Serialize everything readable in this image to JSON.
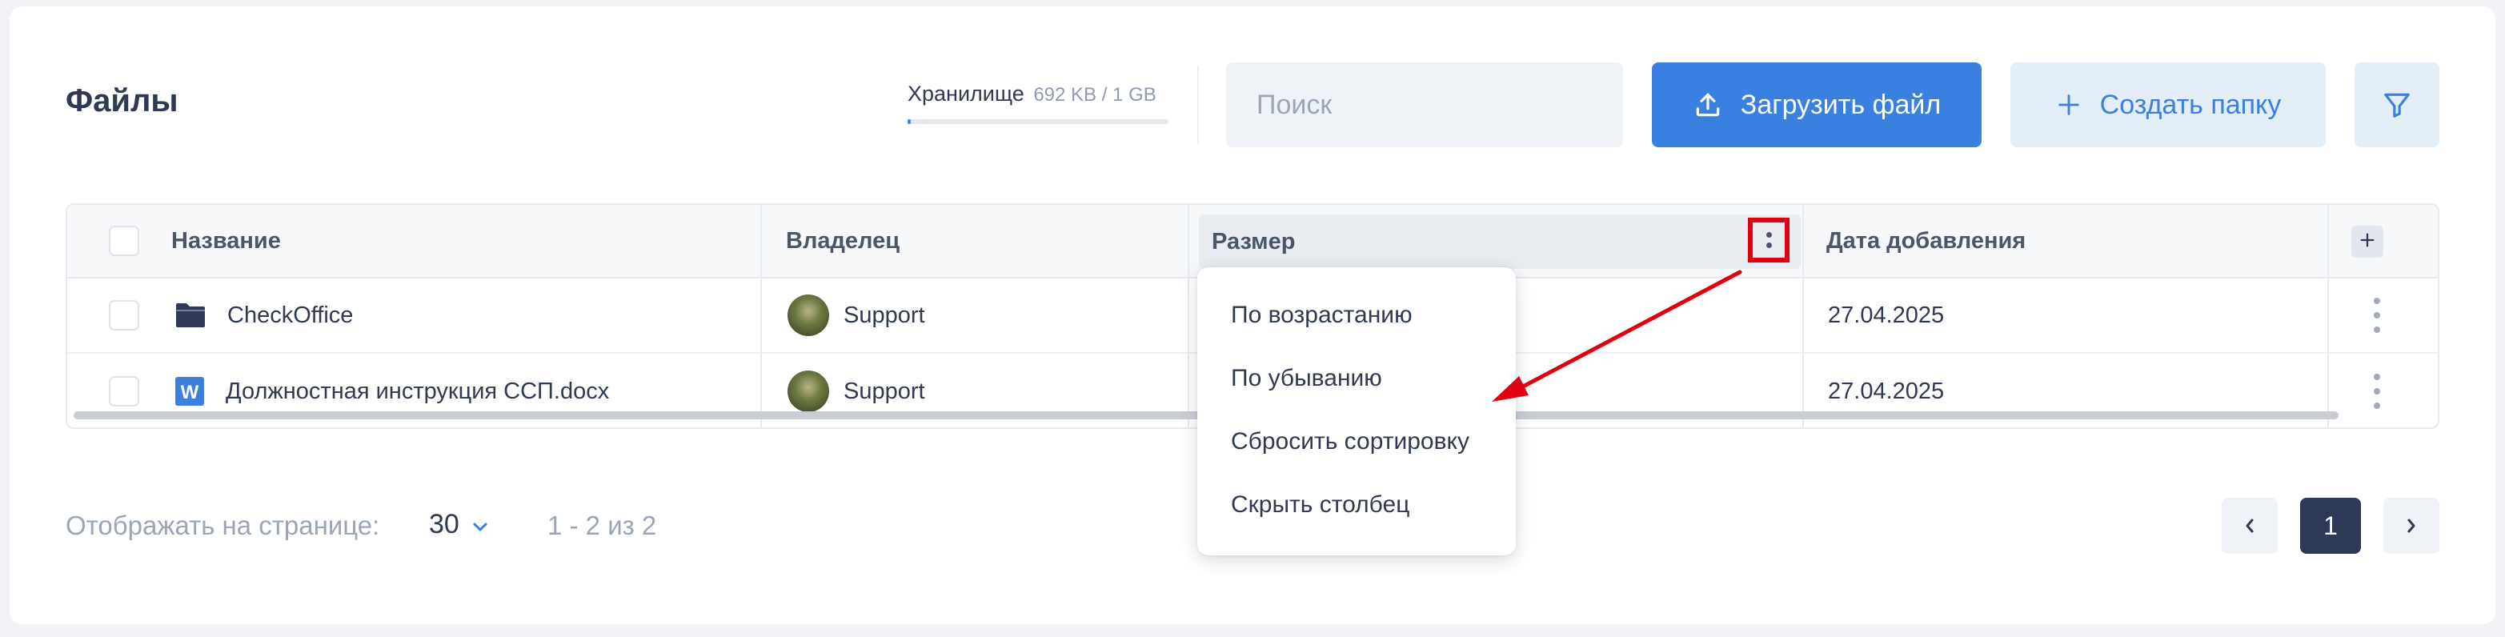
{
  "header": {
    "title": "Файлы",
    "storage_label": "Хранилище",
    "storage_value": "692 KB / 1 GB",
    "storage_used_fraction": 0.0007,
    "search_placeholder": "Поиск",
    "upload_label": "Загрузить файл",
    "create_folder_label": "Создать папку"
  },
  "table": {
    "columns": {
      "name": "Название",
      "owner": "Владелец",
      "size": "Размер",
      "date": "Дата добавления"
    },
    "rows": [
      {
        "type": "folder",
        "name": "CheckOffice",
        "owner": "Support",
        "date": "27.04.2025"
      },
      {
        "type": "word",
        "name": "Должностная инструкция ССП.docx",
        "owner": "Support",
        "date": "27.04.2025",
        "icon_letter": "W"
      }
    ]
  },
  "column_menu": {
    "items": [
      "По возрастанию",
      "По убыванию",
      "Сбросить сортировку",
      "Скрыть столбец"
    ]
  },
  "pagination": {
    "per_page_label": "Отображать на странице:",
    "per_page_value": "30",
    "range": "1 - 2 из 2",
    "current_page": "1"
  },
  "colors": {
    "accent": "#3a80e0",
    "annotation": "#e0000f",
    "dark": "#2e3a55"
  }
}
